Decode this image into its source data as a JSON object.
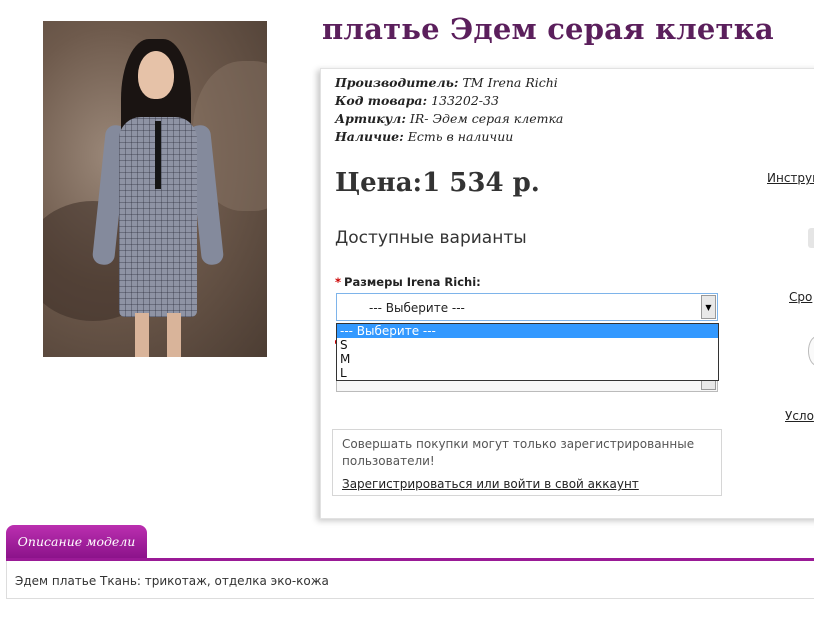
{
  "product": {
    "title": "платье Эдем серая клетка",
    "image_alt": "photo",
    "details": [
      {
        "label": "Производитель:",
        "value": "TM Irena Richi"
      },
      {
        "label": "Код товара:",
        "value": "133202-33"
      },
      {
        "label": "Артикул:",
        "value": "IR- Эдем серая клетка"
      },
      {
        "label": "Наличие:",
        "value": "Есть в наличии"
      }
    ],
    "price": "Цена:1 534 р."
  },
  "options": {
    "heading": "Доступные варианты",
    "size_label": "Размеры Irena Richi:",
    "required_mark": "*",
    "select_value": "--- Выберите ---",
    "dropdown_options": [
      "--- Выберите ---",
      "S",
      "M",
      "L"
    ],
    "selected_index": 0
  },
  "notice": {
    "text": "Совершать покупки могут только зарегистрированные пользователи!",
    "link": "Зарегистрироваться или войти в свой аккаунт"
  },
  "side_links": {
    "instructions": "Инструк",
    "delivery": "Сро",
    "terms": "Усло"
  },
  "tabs": {
    "description_tab": "Описание модели",
    "description_text": "Эдем платье Ткань: трикотаж, отделка эко-кожа"
  },
  "colors": {
    "title": "#5b1f5c",
    "tab_accent": "#9a1a96",
    "dropdown_highlight": "#3399ff"
  }
}
